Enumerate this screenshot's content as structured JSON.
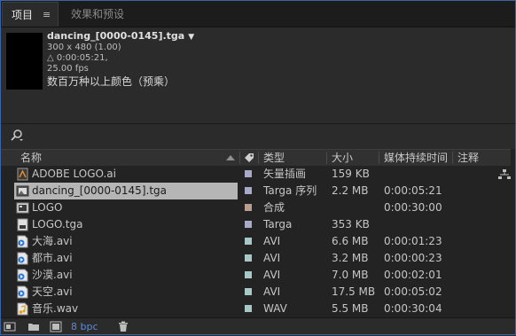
{
  "tabs": [
    {
      "label": "项目",
      "menu_icon": "≡"
    },
    {
      "label": "效果和预设"
    }
  ],
  "preview": {
    "filename": "dancing_[0000-0145].tga",
    "dropdown": "▼",
    "dimensions": "300 x 480 (1.00)",
    "duration": "△ 0:00:05:21, 25.00 fps",
    "color_desc": "数百万种以上颜色（预乘）"
  },
  "search": {
    "icon": "search-icon"
  },
  "columns": {
    "name": "名称",
    "type": "类型",
    "size": "大小",
    "media_duration": "媒体持续时间",
    "comment": "注释"
  },
  "items": [
    {
      "name": "ADOBE LOGO.ai",
      "icon": "illustrator-file",
      "label_color": "#a9a9c8",
      "type": "矢量插画",
      "size": "159 KB",
      "duration": ""
    },
    {
      "name": "dancing_[0000-0145].tga",
      "icon": "image-sequence",
      "label_color": "#a9a9c8",
      "type": "Targa 序列",
      "size": "2.2 MB",
      "duration": "0:00:05:21",
      "selected": true
    },
    {
      "name": "LOGO",
      "icon": "composition",
      "label_color": "#b8a090",
      "type": "合成",
      "size": "",
      "duration": "0:00:30:00"
    },
    {
      "name": "LOGO.tga",
      "icon": "tga-file",
      "label_color": "#a9a9c8",
      "type": "Targa",
      "size": "353 KB",
      "duration": ""
    },
    {
      "name": "大海.avi",
      "icon": "video-file",
      "label_color": "#a8c8c8",
      "type": "AVI",
      "size": "6.6 MB",
      "duration": "0:00:01:23"
    },
    {
      "name": "都市.avi",
      "icon": "video-file",
      "label_color": "#a8c8c8",
      "type": "AVI",
      "size": "3.2 MB",
      "duration": "0:00:00:23"
    },
    {
      "name": "沙漠.avi",
      "icon": "video-file",
      "label_color": "#a8c8c8",
      "type": "AVI",
      "size": "7.0 MB",
      "duration": "0:00:02:01"
    },
    {
      "name": "天空.avi",
      "icon": "video-file",
      "label_color": "#a8c8c8",
      "type": "AVI",
      "size": "17.5 MB",
      "duration": "0:00:05:02"
    },
    {
      "name": "音乐.wav",
      "icon": "audio-file",
      "label_color": "#a8c8c8",
      "type": "WAV",
      "size": "5.5 MB",
      "duration": "0:00:30:04"
    }
  ],
  "footer": {
    "bpc": "8 bpc"
  }
}
